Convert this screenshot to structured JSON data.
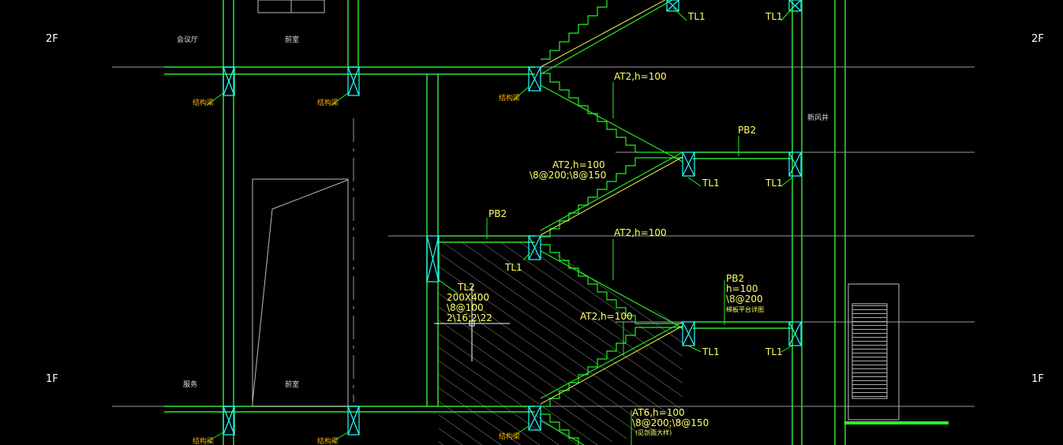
{
  "floor_labels": {
    "upper": "2F",
    "lower": "1F"
  },
  "room_labels": {
    "meeting_room": "会议厅",
    "stair_room_upper": "前室",
    "service_room": "服务",
    "stair_room_lower": "前室",
    "fresh_air_shaft": "新风井"
  },
  "small_callouts": {
    "beam_tag_1": "结构梁",
    "beam_tag_2": "结构梁",
    "beam_tag_3": "结构梁",
    "beam_tag_4": "结构梁",
    "beam_tag_5": "结构梁",
    "beam_tag_6": "结构梁",
    "pb2_note": "梯板平台详图",
    "at6_note": "(见剖面大样)"
  },
  "stair_annotations": {
    "at2_top": "AT2,h=100",
    "at2_mid": "AT2,h=100",
    "at2_mid_rebar": "\\8@200;\\8@150",
    "at2_lower": "AT2,h=100",
    "at2_bottom": "AT2,h=100",
    "at6": "AT6,h=100",
    "at6_rebar": "\\8@200;\\8@150"
  },
  "slab_annotations": {
    "pb2_upper": "PB2",
    "pb2_left": "PB2",
    "pb2_right": "PB2",
    "pb2_right_h": "h=100",
    "pb2_right_rebar": "\\8@200"
  },
  "beam_labels": {
    "tl1_a": "TL1",
    "tl1_b": "TL1",
    "tl1_c": "TL1",
    "tl1_d": "TL1",
    "tl1_e": "TL1",
    "tl1_f": "TL1",
    "tl1_g": "TL1",
    "tl2": "TL2",
    "tl2_size": "200X400",
    "tl2_stirrup": "\\8@100",
    "tl2_bars": "2\\16;2\\22"
  },
  "colors": {
    "background": "#000000",
    "wall_green": "#33e033",
    "stair_green": "#22ee22",
    "cyan": "#22ffff",
    "yellow_text": "#ffff66",
    "white_text": "#ffffff",
    "grey_line": "#9a9a9a",
    "hatch": "#8a8a8a"
  }
}
